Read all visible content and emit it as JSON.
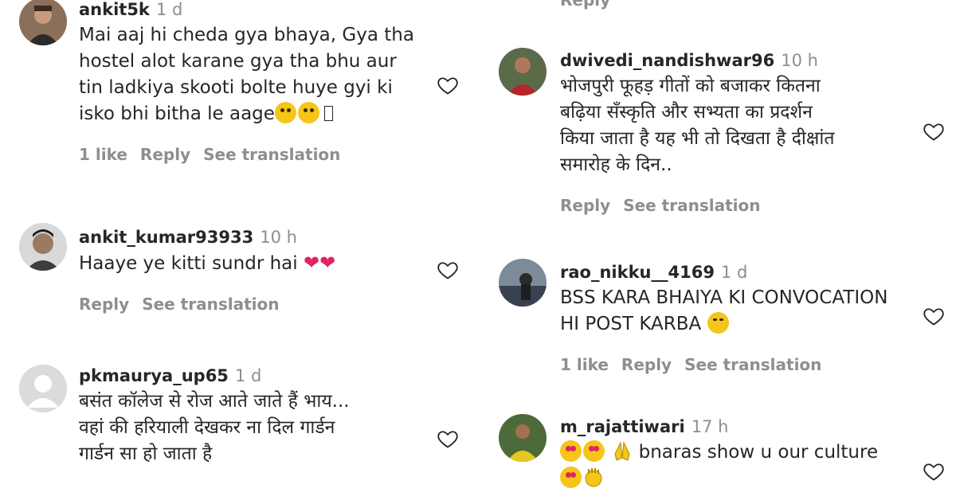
{
  "top_reply_label": "Reply",
  "left_comments": [
    {
      "username": "ankit5k",
      "time": "1 d",
      "lines": [
        "Mai aaj hi cheda gya bhaya, Gya tha",
        "hostel alot karane gya tha bhu aur",
        "tin ladkiya skooti bolte huye gyi ki",
        "isko bhi bitha le aage"
      ],
      "likes": "1 like",
      "reply": "Reply",
      "translate": "See translation"
    },
    {
      "username": "ankit_kumar93933",
      "time": "10 h",
      "lines": [
        "Haaye ye kitti sundr hai"
      ],
      "reply": "Reply",
      "translate": "See translation"
    },
    {
      "username": "pkmaurya_up65",
      "time": "1 d",
      "lines": [
        "बसंत कॉलेज से रोज आते जाते हैं भाय...",
        "वहां की हरियाली देखकर ना दिल गार्डन",
        "गार्डन सा हो जाता है"
      ]
    }
  ],
  "right_comments": [
    {
      "username": "dwivedi_nandishwar96",
      "time": "10 h",
      "lines": [
        "भोजपुरी फूहड़ गीतों को बजाकर कितना",
        "बढ़िया सँस्कृति और सभ्यता का प्रदर्शन",
        "किया जाता है यह भी तो दिखता है दीक्षांत",
        "समारोह के दिन.."
      ],
      "reply": "Reply",
      "translate": "See translation"
    },
    {
      "username": "rao_nikku__4169",
      "time": "1 d",
      "lines": [
        "BSS KARA BHAIYA KI CONVOCATION",
        "HI POST KARBA"
      ],
      "likes": "1 like",
      "reply": "Reply",
      "translate": "See translation"
    },
    {
      "username": "m_rajattiwari",
      "time": "17 h",
      "text_after_emoji": "bnaras show u our culture"
    }
  ],
  "colors": {
    "text": "#262626",
    "muted": "#8e8e8e",
    "heart_outline": "#262626",
    "background": "#ffffff"
  },
  "icons": {
    "like": "heart-outline-icon"
  }
}
